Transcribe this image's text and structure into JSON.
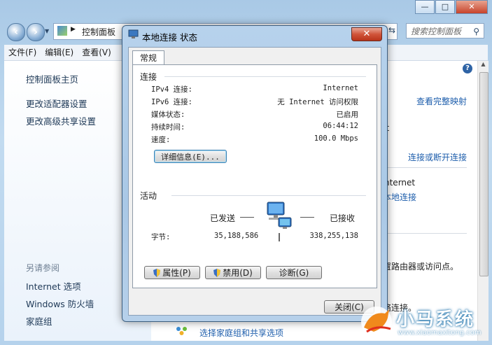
{
  "background_window": {
    "address_item": "控制面板",
    "search_placeholder": "搜索控制面板",
    "menu": [
      "文件(F)",
      "编辑(E)",
      "查看(V)"
    ],
    "sidebar": {
      "home": "控制面板主页",
      "links": [
        "更改适配器设置",
        "更改高级共享设置"
      ],
      "see_also_title": "另请参阅",
      "see_also": [
        "Internet 选项",
        "Windows 防火墙",
        "家庭组"
      ]
    },
    "main": {
      "view_full_map": "查看完整映射",
      "connect_disconnect": "连接或断开连接",
      "partial_et": "et",
      "partial_internet": "nternet",
      "local_connection_link": "本地连接",
      "partial_router": "置路由器或访问点。",
      "partial_connect": "络连接。",
      "homegroup_link": "选择家庭组和共享选项"
    },
    "window_controls": [
      "—",
      "□",
      "✕"
    ]
  },
  "dialog": {
    "title": "本地连接 状态",
    "close_glyph": "✕",
    "tab": "常规",
    "connection": {
      "heading": "连接",
      "rows": [
        {
          "label": "IPv4 连接:",
          "value": "Internet"
        },
        {
          "label": "IPv6 连接:",
          "value": "无 Internet 访问权限"
        },
        {
          "label": "媒体状态:",
          "value": "已启用"
        },
        {
          "label": "持续时间:",
          "value": "06:44:12"
        },
        {
          "label": "速度:",
          "value": "100.0 Mbps"
        }
      ],
      "details_button": "详细信息(E)..."
    },
    "activity": {
      "heading": "活动",
      "sent_label": "已发送",
      "received_label": "已接收",
      "bytes_label": "字节:",
      "bytes_sent": "35,188,586",
      "bytes_received": "338,255,138"
    },
    "buttons": {
      "properties": "属性(P)",
      "disable": "禁用(D)",
      "diagnose": "诊断(G)",
      "close": "关闭(C)"
    }
  },
  "watermark": {
    "text": "小马系统",
    "url": "www.xiaomaxitong.com"
  },
  "colors": {
    "link": "#1e5eac",
    "dialog_frame": "#b7d2ec",
    "close_button": "#d0543a"
  }
}
